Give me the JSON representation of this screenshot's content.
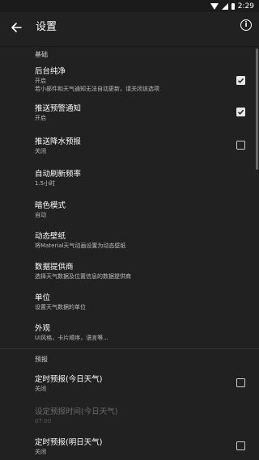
{
  "status_bar": {
    "time": "2:29",
    "wifi_icon": "wifi-icon",
    "signal_icon": "signal-icon",
    "battery_icon": "battery-icon"
  },
  "app_bar": {
    "title": "设置",
    "back_icon": "arrow-back-icon",
    "info_icon": "info-icon"
  },
  "sections": [
    {
      "header": "基础",
      "items": [
        {
          "title": "后台纯净",
          "summary": "开启",
          "summary2": "若小部件和天气通知无法自动更新，请关闭该选项",
          "checkbox": true,
          "checked": true
        },
        {
          "title": "推送预警通知",
          "summary": "开启",
          "checkbox": true,
          "checked": true
        },
        {
          "title": "推送降水预报",
          "summary": "关闭",
          "checkbox": true,
          "checked": false
        },
        {
          "title": "自动刷新频率",
          "summary": "1.5小时"
        },
        {
          "title": "暗色模式",
          "summary": "自动"
        },
        {
          "title": "动态壁纸",
          "summary": "将Material天气动画设置为动态壁纸"
        },
        {
          "title": "数据提供商",
          "summary": "选择天气数据及位置信息的数据提供商"
        },
        {
          "title": "单位",
          "summary": "设置天气数据的单位"
        },
        {
          "title": "外观",
          "summary": "UI风格，卡片顺序，语言等..."
        }
      ]
    },
    {
      "header": "预报",
      "items": [
        {
          "title": "定时预报(今日天气)",
          "summary": "关闭",
          "checkbox": true,
          "checked": false
        },
        {
          "title": "设定预报时间(今日天气)",
          "summary": "07:00",
          "disabled": true
        },
        {
          "title": "定时预报(明日天气)",
          "summary": "关闭",
          "checkbox": true,
          "checked": false
        }
      ]
    }
  ]
}
